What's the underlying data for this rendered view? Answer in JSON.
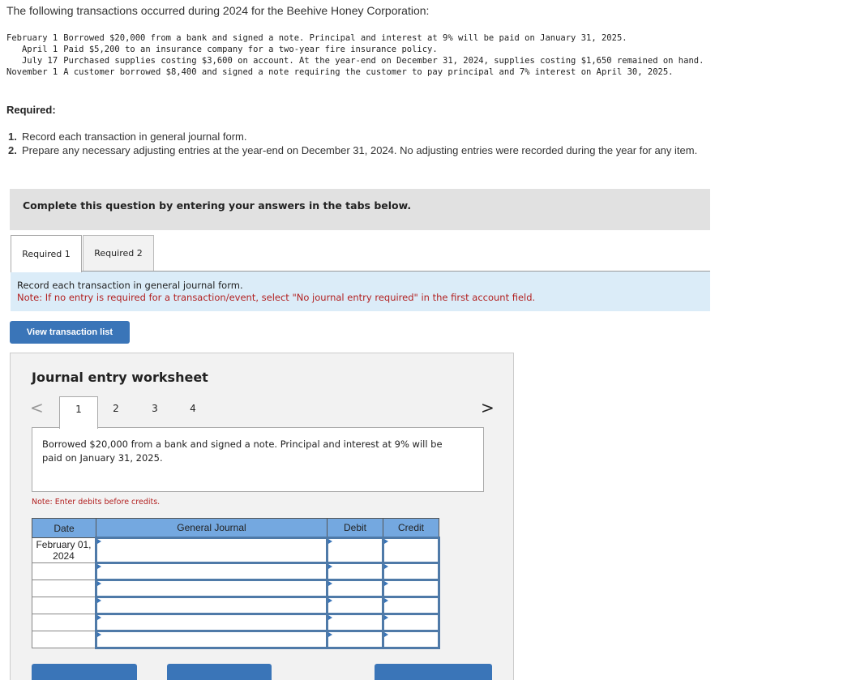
{
  "intro": "The following transactions occurred during 2024 for the Beehive Honey Corporation:",
  "transactions": [
    {
      "date": "February 1",
      "text": "Borrowed $20,000 from a bank and signed a note. Principal and interest at 9% will be paid on January 31, 2025."
    },
    {
      "date": "April 1",
      "text": "Paid $5,200 to an insurance company for a two-year fire insurance policy."
    },
    {
      "date": "July 17",
      "text": "Purchased supplies costing $3,600 on account. At the year-end on December 31, 2024, supplies costing $1,650 remained on hand."
    },
    {
      "date": "November 1",
      "text": "A customer borrowed $8,400 and signed a note requiring the customer to pay principal and 7% interest on April 30, 2025."
    }
  ],
  "required": {
    "heading": "Required:",
    "items": [
      {
        "num": "1.",
        "text": "Record each transaction in general journal form."
      },
      {
        "num": "2.",
        "text": "Prepare any necessary adjusting entries at the year-end on December 31, 2024. No adjusting entries were recorded during the year for any item."
      }
    ]
  },
  "banner": "Complete this question by entering your answers in the tabs below.",
  "tabs": [
    {
      "label": "Required 1",
      "active": true
    },
    {
      "label": "Required 2",
      "active": false
    }
  ],
  "instructions": {
    "line1": "Record each transaction in general journal form.",
    "line2": "Note: If no entry is required for a transaction/event, select \"No journal entry required\" in the first account field."
  },
  "view_button": "View transaction list",
  "worksheet": {
    "title": "Journal entry worksheet",
    "prev_icon": "<",
    "next_icon": ">",
    "pages": [
      "1",
      "2",
      "3",
      "4"
    ],
    "active_page": "1",
    "description": "Borrowed $20,000 from a bank and signed a note. Principal and interest at 9% will be paid on January 31, 2025.",
    "note": "Note: Enter debits before credits.",
    "table": {
      "headers": [
        "Date",
        "General Journal",
        "Debit",
        "Credit"
      ],
      "rows": [
        {
          "date": "February 01, 2024",
          "account": "",
          "debit": "",
          "credit": ""
        },
        {
          "date": "",
          "account": "",
          "debit": "",
          "credit": ""
        },
        {
          "date": "",
          "account": "",
          "debit": "",
          "credit": ""
        },
        {
          "date": "",
          "account": "",
          "debit": "",
          "credit": ""
        },
        {
          "date": "",
          "account": "",
          "debit": "",
          "credit": ""
        },
        {
          "date": "",
          "account": "",
          "debit": "",
          "credit": ""
        }
      ]
    }
  },
  "colors": {
    "primary_button": "#3a75b8",
    "table_header": "#74a8e0",
    "note_red": "#b22222",
    "instruction_bg": "#dbecf8"
  }
}
